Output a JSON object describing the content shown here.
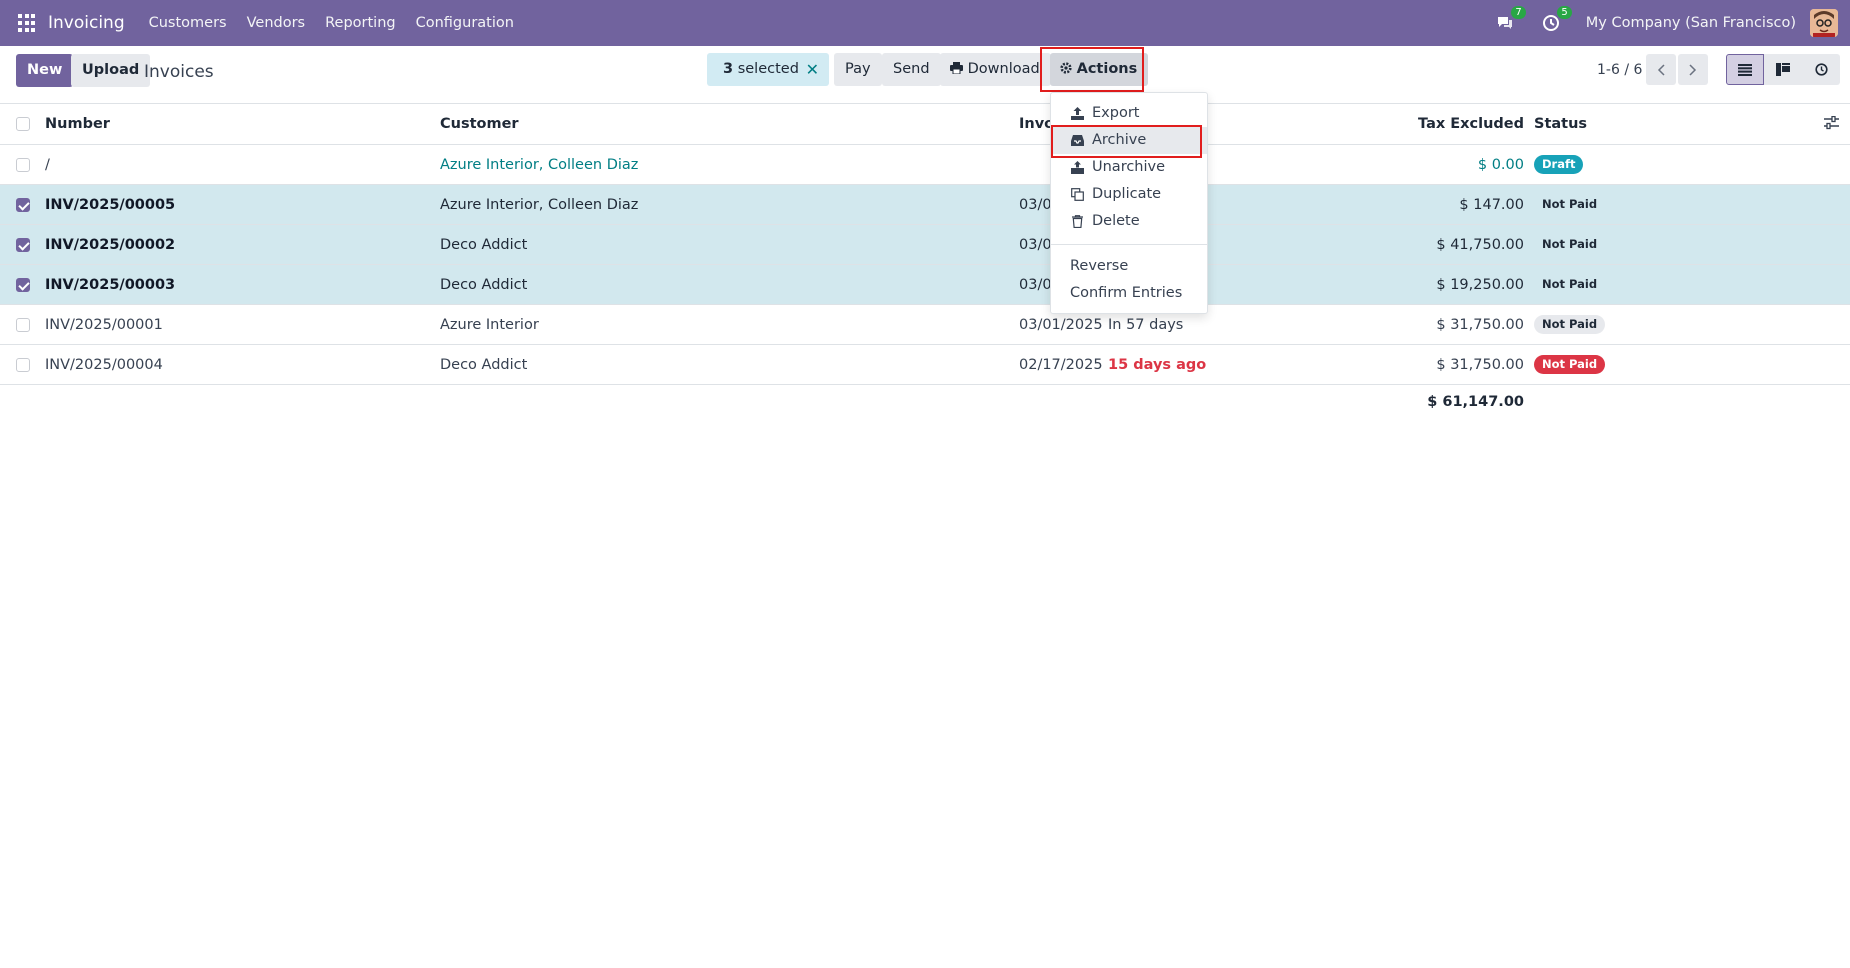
{
  "navbar": {
    "brand": "Invoicing",
    "menu": [
      "Customers",
      "Vendors",
      "Reporting",
      "Configuration"
    ],
    "messages_count": "7",
    "activities_count": "5",
    "company": "My Company (San Francisco)"
  },
  "control": {
    "new_label": "New",
    "upload_label": "Upload",
    "title": "Invoices",
    "selected_count": "3",
    "selected_text": "selected",
    "pay_label": "Pay",
    "send_label": "Send",
    "download_label": "Download",
    "actions_label": "Actions",
    "pager": "1-6 / 6"
  },
  "table": {
    "headers": {
      "number": "Number",
      "customer": "Customer",
      "invoice_date": "Invoi",
      "tax_excluded": "Tax Excluded",
      "status": "Status"
    },
    "rows": [
      {
        "number": "/",
        "customer": "Azure Interior, Colleen Diaz",
        "date": "",
        "due": "",
        "amount": "$ 0.00",
        "status": "Draft",
        "selected": false
      },
      {
        "number": "INV/2025/00005",
        "customer": "Azure Interior, Colleen Diaz",
        "date": "03/0",
        "due": "",
        "amount": "$ 147.00",
        "status": "Not Paid",
        "selected": true
      },
      {
        "number": "INV/2025/00002",
        "customer": "Deco Addict",
        "date": "03/0",
        "due": "",
        "amount": "$ 41,750.00",
        "status": "Not Paid",
        "selected": true
      },
      {
        "number": "INV/2025/00003",
        "customer": "Deco Addict",
        "date": "03/0",
        "due": "",
        "amount": "$ 19,250.00",
        "status": "Not Paid",
        "selected": true
      },
      {
        "number": "INV/2025/00001",
        "customer": "Azure Interior",
        "date": "03/01/2025",
        "due": "In 57 days",
        "amount": "$ 31,750.00",
        "status": "Not Paid",
        "selected": false
      },
      {
        "number": "INV/2025/00004",
        "customer": "Deco Addict",
        "date": "02/17/2025",
        "due": "15 days ago",
        "amount": "$ 31,750.00",
        "status": "Not Paid",
        "selected": false
      }
    ],
    "total": "$ 61,147.00"
  },
  "actions_menu": {
    "items": [
      "Export",
      "Archive",
      "Unarchive",
      "Duplicate",
      "Delete"
    ],
    "extra_items": [
      "Reverse",
      "Confirm Entries"
    ]
  },
  "colors": {
    "brand": "#71639e",
    "link": "#017e84",
    "danger": "#dc3545",
    "highlight": "#e11d1d"
  }
}
